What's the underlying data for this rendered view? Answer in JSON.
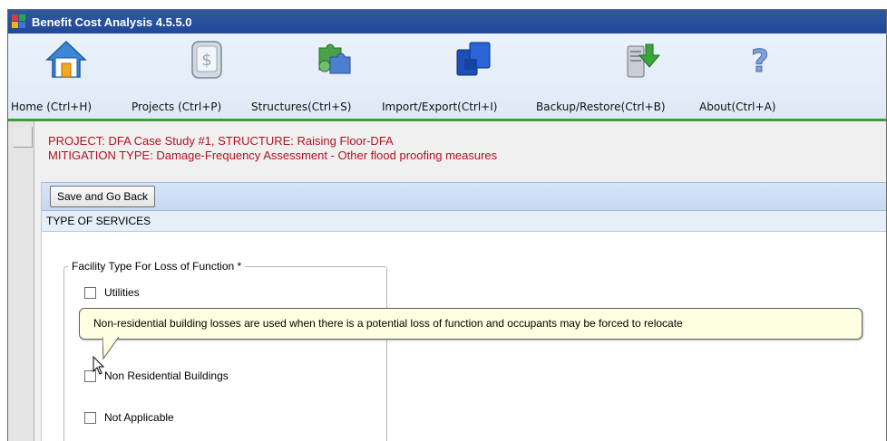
{
  "window": {
    "title": "Benefit Cost Analysis 4.5.5.0"
  },
  "toolbar": {
    "items": [
      {
        "label": "Home (Ctrl+H)",
        "icon": "home-icon"
      },
      {
        "label": "Projects (Ctrl+P)",
        "icon": "projects-icon"
      },
      {
        "label": "Structures(Ctrl+S)",
        "icon": "structures-icon"
      },
      {
        "label": "Import/Export(Ctrl+I)",
        "icon": "import-export-icon"
      },
      {
        "label": "Backup/Restore(Ctrl+B)",
        "icon": "backup-restore-icon"
      },
      {
        "label": "About(Ctrl+A)",
        "icon": "about-icon"
      }
    ]
  },
  "project_info": {
    "line1": "PROJECT: DFA Case Study #1, STRUCTURE: Raising Floor-DFA",
    "line2": "MITIGATION TYPE: Damage-Frequency Assessment - Other flood proofing measures"
  },
  "actions": {
    "save_label": "Save and Go Back"
  },
  "section": {
    "title": "TYPE OF SERVICES"
  },
  "facility_group": {
    "legend": "Facility Type For Loss of Function *",
    "options": [
      {
        "label": "Utilities",
        "checked": false
      },
      {
        "label": "Non Residential Buildings",
        "checked": false
      },
      {
        "label": "Not Applicable",
        "checked": false
      }
    ]
  },
  "tooltip": {
    "text": "Non-residential building losses are used when there is a potential loss of function and occupants may be forced to relocate"
  },
  "colors": {
    "title_bar": "#23479a",
    "toolbar_accent": "#3a9e3a",
    "info_text": "#b0121f",
    "tooltip_bg": "#ffffe1"
  }
}
